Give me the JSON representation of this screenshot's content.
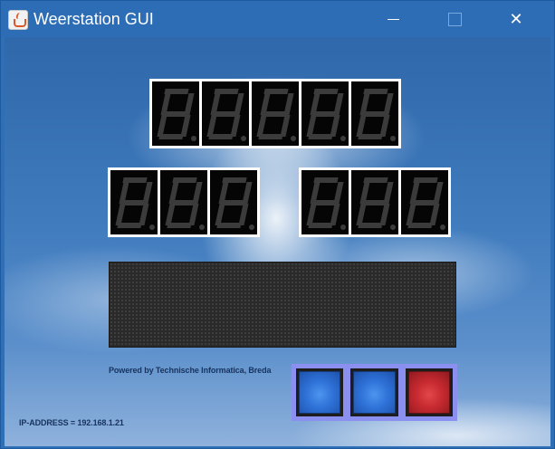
{
  "window": {
    "title": "Weerstation GUI",
    "app_icon": "java-cup-icon",
    "controls": {
      "minimize": "minimize-icon",
      "maximize": "maximize-icon",
      "close_glyph": "✕"
    }
  },
  "displays": {
    "top_row_digits": 5,
    "left_row_digits": 3,
    "right_row_digits": 3,
    "segments_lit": false
  },
  "matrix_display": {
    "text": ""
  },
  "footer": {
    "powered_by": "Powered by Technische Informatica,  Breda",
    "ip_address": "IP-ADDRESS = 192.168.1.21"
  },
  "buttons": [
    {
      "name": "blue-button-1",
      "color": "#2f72d8"
    },
    {
      "name": "blue-button-2",
      "color": "#2f72d8"
    },
    {
      "name": "red-button",
      "color": "#c62a30"
    }
  ],
  "colors": {
    "titlebar": "#2c6db5",
    "button_panel": "#8b8ff0",
    "segment_off": "#3b3b3b"
  }
}
